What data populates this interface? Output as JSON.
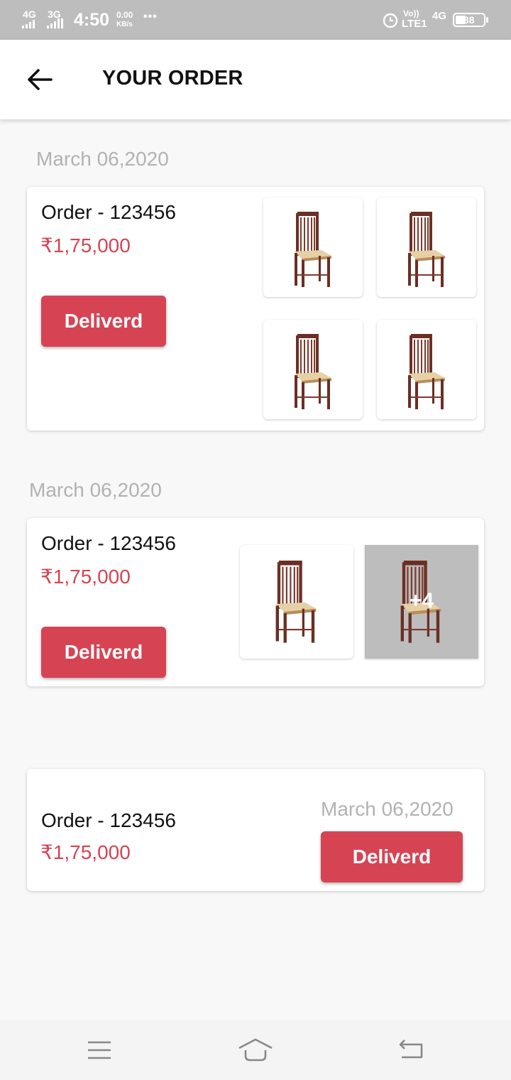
{
  "status_bar": {
    "net1": "4G",
    "net2": "3G",
    "time": "4:50",
    "speed_value": "0.00",
    "speed_unit": "KB/s",
    "dots": "•••",
    "volte_top": "Vo))",
    "volte_bottom": "LTE1",
    "net3": "4G",
    "battery": "38"
  },
  "header": {
    "title": "YOUR ORDER"
  },
  "orders": [
    {
      "date": "March 06,2020",
      "order_label": "Order - 123456",
      "price": "₹1,75,000",
      "status": "Deliverd"
    },
    {
      "date": "March 06,2020",
      "order_label": "Order - 123456",
      "price": "₹1,75,000",
      "status": "Deliverd",
      "more_count": "+4"
    },
    {
      "date": "March 06,2020",
      "order_label": "Order - 123456",
      "price": "₹1,75,000",
      "status": "Deliverd"
    }
  ],
  "colors": {
    "accent": "#d64453",
    "price": "#d44452",
    "date": "#b2b2b2",
    "statusbar": "#bdbdbd"
  },
  "icons": {
    "back": "arrow-left-icon",
    "chair": "chair-icon",
    "menu": "menu-icon",
    "home": "home-icon",
    "nav_back": "back-nav-icon",
    "alarm": "alarm-icon",
    "battery": "battery-icon"
  }
}
